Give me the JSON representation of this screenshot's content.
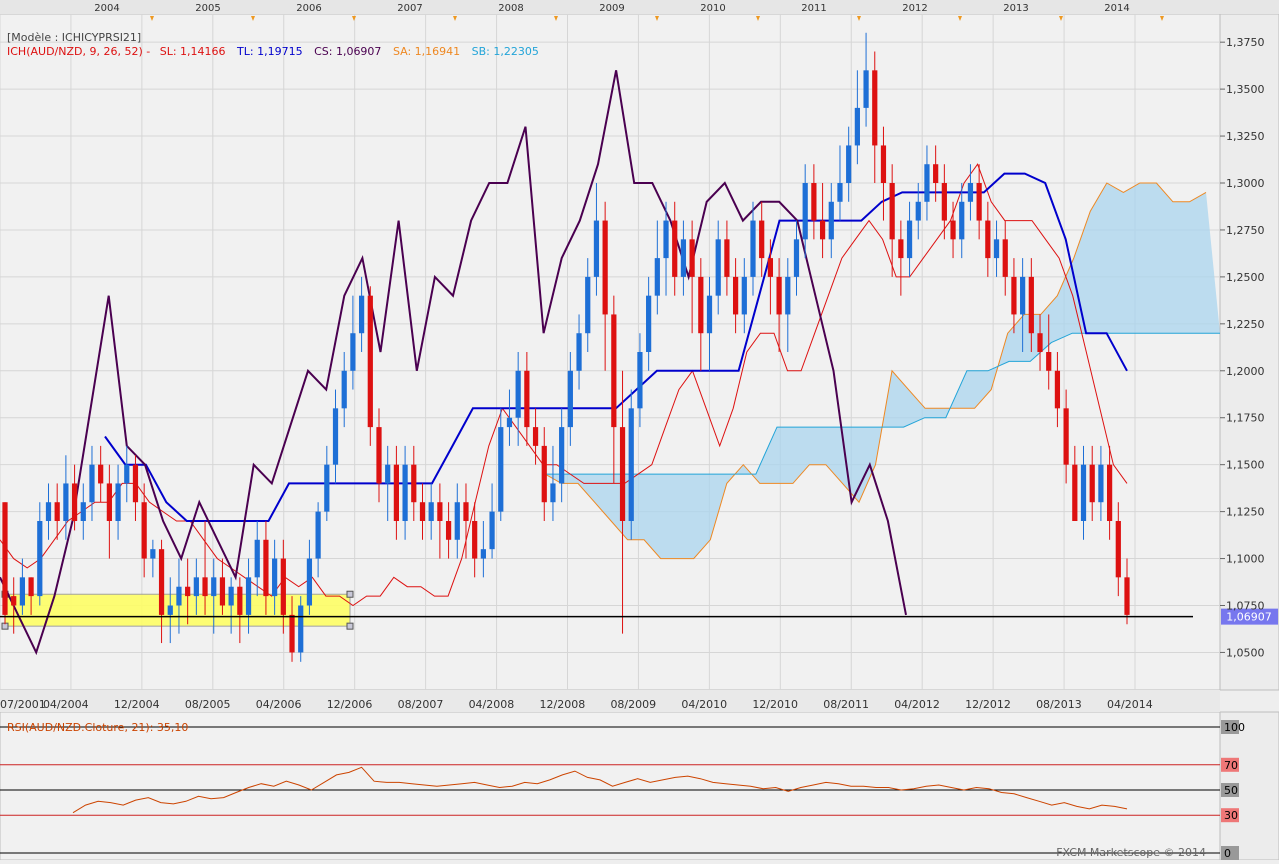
{
  "header": {
    "model_label": "[Modèle : ICHICYPRSI21]",
    "indicator_label": "ICH(AUD/NZD, 9, 26, 52) -",
    "sl": "SL: 1,14166",
    "tl": "TL: 1,19715",
    "cs": "CS: 1,06907",
    "sa": "SA: 1,16941",
    "sb": "SB: 1,22305"
  },
  "footer": {
    "rsi_label": "RSI(AUD/NZD.Cloture, 21): 35,10",
    "copyright": "FXCM Marketscope © 2014"
  },
  "colors": {
    "background": "#eeeeee",
    "grid": "#d6d6d6",
    "bull_candle": "#1e6fd6",
    "bear_candle": "#dd1111",
    "tenkan_sl": "#dd1111",
    "kijun_tl": "#0000cc",
    "chikou_cs": "#4a0050",
    "senkou_sa": "#ee8822",
    "senkou_sb": "#22a4d8",
    "cloud_fill": "#a9d4ee",
    "cloud_fill_bear": "#f4c7a0",
    "highlight_zone": "#ffff66",
    "price_marker": "#7777ee",
    "rsi_line": "#cc4400"
  },
  "chart_data": [
    {
      "type": "candlestick",
      "title": "",
      "symbol": "AUD/NZD",
      "ylim": [
        1.03,
        1.39
      ],
      "y_ticks": [
        "1,0500",
        "1,0750",
        "1,1000",
        "1,1250",
        "1,1500",
        "1,1750",
        "1,2000",
        "1,2250",
        "1,2500",
        "1,2750",
        "1,3000",
        "1,3250",
        "1,3500",
        "1,3750"
      ],
      "y_tick_values": [
        1.05,
        1.075,
        1.1,
        1.125,
        1.15,
        1.175,
        1.2,
        1.225,
        1.25,
        1.275,
        1.3,
        1.325,
        1.35,
        1.375
      ],
      "x_ticks_bottom": [
        "07/2001",
        "04/2004",
        "12/2004",
        "08/2005",
        "04/2006",
        "12/2006",
        "08/2007",
        "04/2008",
        "12/2008",
        "08/2009",
        "04/2010",
        "12/2010",
        "08/2011",
        "04/2012",
        "12/2012",
        "08/2013",
        "04/2014"
      ],
      "x_ticks_top": [
        "2004",
        "2005",
        "2006",
        "2007",
        "2008",
        "2009",
        "2010",
        "2011",
        "2012",
        "2013",
        "2014"
      ],
      "last_price": "1,06907",
      "last_price_value": 1.06907,
      "candles": [
        [
          1.13,
          1.07,
          1.13,
          1.065
        ],
        [
          1.08,
          1.075,
          1.09,
          1.06
        ],
        [
          1.075,
          1.09,
          1.1,
          1.07
        ],
        [
          1.09,
          1.08,
          1.09,
          1.07
        ],
        [
          1.08,
          1.12,
          1.13,
          1.075
        ],
        [
          1.12,
          1.13,
          1.14,
          1.11
        ],
        [
          1.13,
          1.12,
          1.14,
          1.11
        ],
        [
          1.12,
          1.14,
          1.155,
          1.11
        ],
        [
          1.14,
          1.12,
          1.15,
          1.115
        ],
        [
          1.12,
          1.13,
          1.14,
          1.11
        ],
        [
          1.13,
          1.15,
          1.16,
          1.12
        ],
        [
          1.15,
          1.14,
          1.16,
          1.13
        ],
        [
          1.14,
          1.12,
          1.15,
          1.1
        ],
        [
          1.12,
          1.14,
          1.15,
          1.11
        ],
        [
          1.14,
          1.15,
          1.16,
          1.13
        ],
        [
          1.15,
          1.13,
          1.155,
          1.12
        ],
        [
          1.13,
          1.1,
          1.14,
          1.09
        ],
        [
          1.1,
          1.105,
          1.11,
          1.09
        ],
        [
          1.105,
          1.07,
          1.11,
          1.055
        ],
        [
          1.07,
          1.075,
          1.09,
          1.055
        ],
        [
          1.075,
          1.085,
          1.1,
          1.06
        ],
        [
          1.085,
          1.08,
          1.1,
          1.065
        ],
        [
          1.08,
          1.09,
          1.1,
          1.07
        ],
        [
          1.09,
          1.08,
          1.12,
          1.07
        ],
        [
          1.08,
          1.09,
          1.1,
          1.06
        ],
        [
          1.09,
          1.075,
          1.1,
          1.07
        ],
        [
          1.075,
          1.085,
          1.09,
          1.06
        ],
        [
          1.085,
          1.07,
          1.09,
          1.055
        ],
        [
          1.07,
          1.09,
          1.1,
          1.06
        ],
        [
          1.09,
          1.11,
          1.12,
          1.08
        ],
        [
          1.11,
          1.08,
          1.12,
          1.07
        ],
        [
          1.08,
          1.1,
          1.11,
          1.07
        ],
        [
          1.1,
          1.07,
          1.11,
          1.06
        ],
        [
          1.07,
          1.05,
          1.08,
          1.045
        ],
        [
          1.05,
          1.075,
          1.08,
          1.045
        ],
        [
          1.075,
          1.1,
          1.11,
          1.07
        ],
        [
          1.1,
          1.125,
          1.13,
          1.09
        ],
        [
          1.125,
          1.15,
          1.16,
          1.12
        ],
        [
          1.15,
          1.18,
          1.19,
          1.14
        ],
        [
          1.18,
          1.2,
          1.21,
          1.17
        ],
        [
          1.2,
          1.22,
          1.24,
          1.19
        ],
        [
          1.22,
          1.24,
          1.25,
          1.21
        ],
        [
          1.24,
          1.17,
          1.245,
          1.16
        ],
        [
          1.17,
          1.14,
          1.18,
          1.13
        ],
        [
          1.14,
          1.15,
          1.16,
          1.12
        ],
        [
          1.15,
          1.12,
          1.16,
          1.11
        ],
        [
          1.12,
          1.15,
          1.16,
          1.11
        ],
        [
          1.15,
          1.13,
          1.16,
          1.12
        ],
        [
          1.13,
          1.12,
          1.14,
          1.11
        ],
        [
          1.12,
          1.13,
          1.14,
          1.11
        ],
        [
          1.13,
          1.12,
          1.14,
          1.1
        ],
        [
          1.12,
          1.11,
          1.13,
          1.1
        ],
        [
          1.11,
          1.13,
          1.14,
          1.1
        ],
        [
          1.13,
          1.12,
          1.14,
          1.1
        ],
        [
          1.12,
          1.1,
          1.13,
          1.09
        ],
        [
          1.1,
          1.105,
          1.12,
          1.09
        ],
        [
          1.105,
          1.125,
          1.14,
          1.1
        ],
        [
          1.125,
          1.17,
          1.18,
          1.12
        ],
        [
          1.17,
          1.175,
          1.19,
          1.16
        ],
        [
          1.175,
          1.2,
          1.21,
          1.16
        ],
        [
          1.2,
          1.17,
          1.21,
          1.16
        ],
        [
          1.17,
          1.16,
          1.18,
          1.15
        ],
        [
          1.16,
          1.13,
          1.17,
          1.12
        ],
        [
          1.13,
          1.14,
          1.16,
          1.12
        ],
        [
          1.14,
          1.17,
          1.18,
          1.13
        ],
        [
          1.17,
          1.2,
          1.21,
          1.16
        ],
        [
          1.2,
          1.22,
          1.23,
          1.19
        ],
        [
          1.22,
          1.25,
          1.26,
          1.21
        ],
        [
          1.25,
          1.28,
          1.3,
          1.24
        ],
        [
          1.28,
          1.23,
          1.29,
          1.2
        ],
        [
          1.23,
          1.17,
          1.24,
          1.14
        ],
        [
          1.17,
          1.12,
          1.2,
          1.06
        ],
        [
          1.12,
          1.18,
          1.19,
          1.11
        ],
        [
          1.18,
          1.21,
          1.22,
          1.17
        ],
        [
          1.21,
          1.24,
          1.25,
          1.2
        ],
        [
          1.24,
          1.26,
          1.28,
          1.23
        ],
        [
          1.26,
          1.28,
          1.29,
          1.24
        ],
        [
          1.28,
          1.25,
          1.29,
          1.24
        ],
        [
          1.25,
          1.27,
          1.28,
          1.24
        ],
        [
          1.27,
          1.25,
          1.28,
          1.22
        ],
        [
          1.25,
          1.22,
          1.26,
          1.2
        ],
        [
          1.22,
          1.24,
          1.25,
          1.2
        ],
        [
          1.24,
          1.27,
          1.28,
          1.23
        ],
        [
          1.27,
          1.25,
          1.28,
          1.24
        ],
        [
          1.25,
          1.23,
          1.26,
          1.22
        ],
        [
          1.23,
          1.25,
          1.26,
          1.22
        ],
        [
          1.25,
          1.28,
          1.29,
          1.24
        ],
        [
          1.28,
          1.26,
          1.29,
          1.25
        ],
        [
          1.26,
          1.25,
          1.27,
          1.23
        ],
        [
          1.25,
          1.23,
          1.26,
          1.21
        ],
        [
          1.23,
          1.25,
          1.26,
          1.21
        ],
        [
          1.25,
          1.27,
          1.28,
          1.24
        ],
        [
          1.27,
          1.3,
          1.31,
          1.26
        ],
        [
          1.3,
          1.28,
          1.31,
          1.27
        ],
        [
          1.28,
          1.27,
          1.3,
          1.26
        ],
        [
          1.27,
          1.29,
          1.3,
          1.26
        ],
        [
          1.29,
          1.3,
          1.32,
          1.28
        ],
        [
          1.3,
          1.32,
          1.33,
          1.29
        ],
        [
          1.32,
          1.34,
          1.36,
          1.31
        ],
        [
          1.34,
          1.36,
          1.38,
          1.33
        ],
        [
          1.36,
          1.32,
          1.37,
          1.3
        ],
        [
          1.32,
          1.3,
          1.33,
          1.28
        ],
        [
          1.3,
          1.27,
          1.31,
          1.25
        ],
        [
          1.27,
          1.26,
          1.28,
          1.24
        ],
        [
          1.26,
          1.28,
          1.29,
          1.25
        ],
        [
          1.28,
          1.29,
          1.3,
          1.27
        ],
        [
          1.29,
          1.31,
          1.32,
          1.28
        ],
        [
          1.31,
          1.3,
          1.32,
          1.29
        ],
        [
          1.3,
          1.28,
          1.31,
          1.27
        ],
        [
          1.28,
          1.27,
          1.29,
          1.26
        ],
        [
          1.27,
          1.29,
          1.3,
          1.26
        ],
        [
          1.29,
          1.3,
          1.31,
          1.28
        ],
        [
          1.3,
          1.28,
          1.31,
          1.27
        ],
        [
          1.28,
          1.26,
          1.29,
          1.25
        ],
        [
          1.26,
          1.27,
          1.28,
          1.25
        ],
        [
          1.27,
          1.25,
          1.28,
          1.24
        ],
        [
          1.25,
          1.23,
          1.26,
          1.22
        ],
        [
          1.23,
          1.25,
          1.26,
          1.21
        ],
        [
          1.25,
          1.22,
          1.26,
          1.21
        ],
        [
          1.22,
          1.21,
          1.23,
          1.2
        ],
        [
          1.21,
          1.2,
          1.23,
          1.19
        ],
        [
          1.2,
          1.18,
          1.21,
          1.17
        ],
        [
          1.18,
          1.15,
          1.19,
          1.14
        ],
        [
          1.15,
          1.12,
          1.16,
          1.12
        ],
        [
          1.12,
          1.15,
          1.16,
          1.11
        ],
        [
          1.15,
          1.13,
          1.16,
          1.12
        ],
        [
          1.13,
          1.15,
          1.16,
          1.12
        ],
        [
          1.15,
          1.12,
          1.16,
          1.11
        ],
        [
          1.12,
          1.09,
          1.13,
          1.08
        ],
        [
          1.09,
          1.07,
          1.1,
          1.065
        ]
      ],
      "tenkan_sl": [
        1.11,
        1.1,
        1.095,
        1.1,
        1.11,
        1.12,
        1.125,
        1.13,
        1.13,
        1.14,
        1.14,
        1.13,
        1.125,
        1.12,
        1.12,
        1.11,
        1.1,
        1.095,
        1.09,
        1.085,
        1.08,
        1.09,
        1.085,
        1.09,
        1.08,
        1.08,
        1.075,
        1.08,
        1.08,
        1.09,
        1.085,
        1.085,
        1.08,
        1.08,
        1.1,
        1.13,
        1.16,
        1.18,
        1.17,
        1.16,
        1.15,
        1.15,
        1.145,
        1.14,
        1.14,
        1.14,
        1.14,
        1.145,
        1.15,
        1.17,
        1.19,
        1.2,
        1.18,
        1.16,
        1.18,
        1.21,
        1.22,
        1.22,
        1.2,
        1.2,
        1.22,
        1.24,
        1.26,
        1.27,
        1.28,
        1.27,
        1.25,
        1.25,
        1.26,
        1.27,
        1.28,
        1.3,
        1.31,
        1.29,
        1.28,
        1.28,
        1.28,
        1.27,
        1.26,
        1.24,
        1.21,
        1.18,
        1.15,
        1.14
      ],
      "kijun_tl": [
        1.165,
        1.15,
        1.15,
        1.13,
        1.12,
        1.12,
        1.12,
        1.12,
        1.12,
        1.14,
        1.14,
        1.14,
        1.14,
        1.14,
        1.14,
        1.14,
        1.14,
        1.16,
        1.18,
        1.18,
        1.18,
        1.18,
        1.18,
        1.18,
        1.18,
        1.18,
        1.19,
        1.2,
        1.2,
        1.2,
        1.2,
        1.2,
        1.24,
        1.28,
        1.28,
        1.28,
        1.28,
        1.28,
        1.29,
        1.295,
        1.295,
        1.295,
        1.295,
        1.295,
        1.305,
        1.305,
        1.3,
        1.27,
        1.22,
        1.22,
        1.2
      ],
      "chikou_cs": [
        1.09,
        1.07,
        1.05,
        1.08,
        1.12,
        1.18,
        1.24,
        1.16,
        1.15,
        1.12,
        1.1,
        1.13,
        1.11,
        1.09,
        1.15,
        1.14,
        1.17,
        1.2,
        1.19,
        1.24,
        1.26,
        1.21,
        1.28,
        1.2,
        1.25,
        1.24,
        1.28,
        1.3,
        1.3,
        1.33,
        1.22,
        1.26,
        1.28,
        1.31,
        1.36,
        1.3,
        1.3,
        1.28,
        1.25,
        1.29,
        1.3,
        1.28,
        1.29,
        1.29,
        1.28,
        1.24,
        1.2,
        1.13,
        1.15,
        1.12,
        1.07
      ],
      "senkou_sa": [
        1.145,
        1.14,
        1.14,
        1.13,
        1.12,
        1.11,
        1.11,
        1.1,
        1.1,
        1.1,
        1.11,
        1.14,
        1.15,
        1.14,
        1.14,
        1.14,
        1.15,
        1.15,
        1.14,
        1.13,
        1.15,
        1.2,
        1.19,
        1.18,
        1.18,
        1.18,
        1.18,
        1.19,
        1.22,
        1.23,
        1.23,
        1.24,
        1.26,
        1.285,
        1.3,
        1.295,
        1.3,
        1.3,
        1.29,
        1.29,
        1.295
      ],
      "senkou_sb": [
        1.145,
        1.145,
        1.145,
        1.145,
        1.145,
        1.145,
        1.145,
        1.145,
        1.145,
        1.145,
        1.145,
        1.17,
        1.17,
        1.17,
        1.17,
        1.17,
        1.17,
        1.17,
        1.175,
        1.175,
        1.2,
        1.2,
        1.205,
        1.205,
        1.215,
        1.22,
        1.22,
        1.22,
        1.22,
        1.22,
        1.22,
        1.22,
        1.22
      ],
      "highlight_zone": {
        "y_low": 1.064,
        "y_high": 1.081
      }
    },
    {
      "type": "line",
      "title": "",
      "name": "RSI(AUD/NZD.Cloture, 21)",
      "levels": [
        100,
        70,
        50,
        30,
        0
      ],
      "level_labels": [
        "100",
        "70",
        "50",
        "30",
        "0"
      ],
      "ylim": [
        0,
        100
      ],
      "values": [
        32,
        38,
        41,
        40,
        38,
        42,
        44,
        40,
        39,
        41,
        45,
        43,
        44,
        48,
        52,
        55,
        53,
        57,
        54,
        50,
        56,
        62,
        64,
        68,
        57,
        56,
        56,
        55,
        54,
        53,
        54,
        55,
        56,
        54,
        52,
        53,
        56,
        55,
        58,
        62,
        65,
        60,
        58,
        53,
        56,
        59,
        56,
        58,
        60,
        61,
        59,
        56,
        55,
        54,
        53,
        51,
        52,
        49,
        52,
        54,
        56,
        55,
        53,
        53,
        52,
        52,
        50,
        51,
        53,
        54,
        52,
        50,
        52,
        51,
        48,
        47,
        44,
        41,
        38,
        40,
        37,
        35,
        38,
        37,
        35
      ]
    }
  ]
}
